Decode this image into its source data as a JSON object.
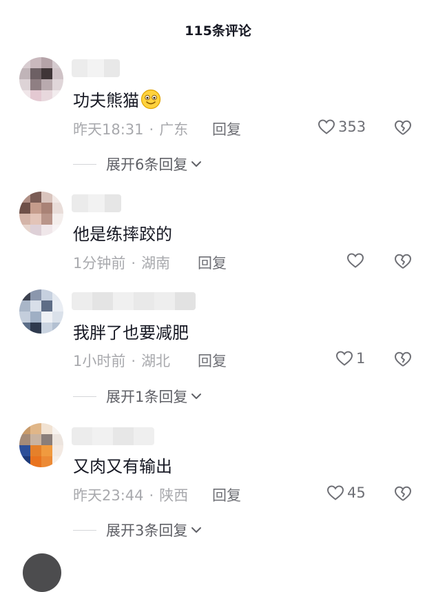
{
  "header": {
    "title": "115条评论"
  },
  "comments": [
    {
      "text": "功夫熊猫",
      "emoji": "smiling-face-emoji",
      "time": "昨天18:31",
      "location": "广东",
      "reply_label": "回复",
      "likes": "353",
      "expand": "展开6条回复"
    },
    {
      "text": "他是练摔跤的",
      "time": "1分钟前",
      "location": "湖南",
      "reply_label": "回复",
      "likes": "",
      "expand": ""
    },
    {
      "text": "我胖了也要减肥",
      "time": "1小时前",
      "location": "湖北",
      "reply_label": "回复",
      "likes": "1",
      "expand": "展开1条回复"
    },
    {
      "text": "又肉又有输出",
      "time": "昨天23:44",
      "location": "陕西",
      "reply_label": "回复",
      "likes": "45",
      "expand": "展开3条回复"
    }
  ],
  "colors": {
    "text": "#161823",
    "meta": "#a8a9ad",
    "action": "#6e6f75"
  }
}
